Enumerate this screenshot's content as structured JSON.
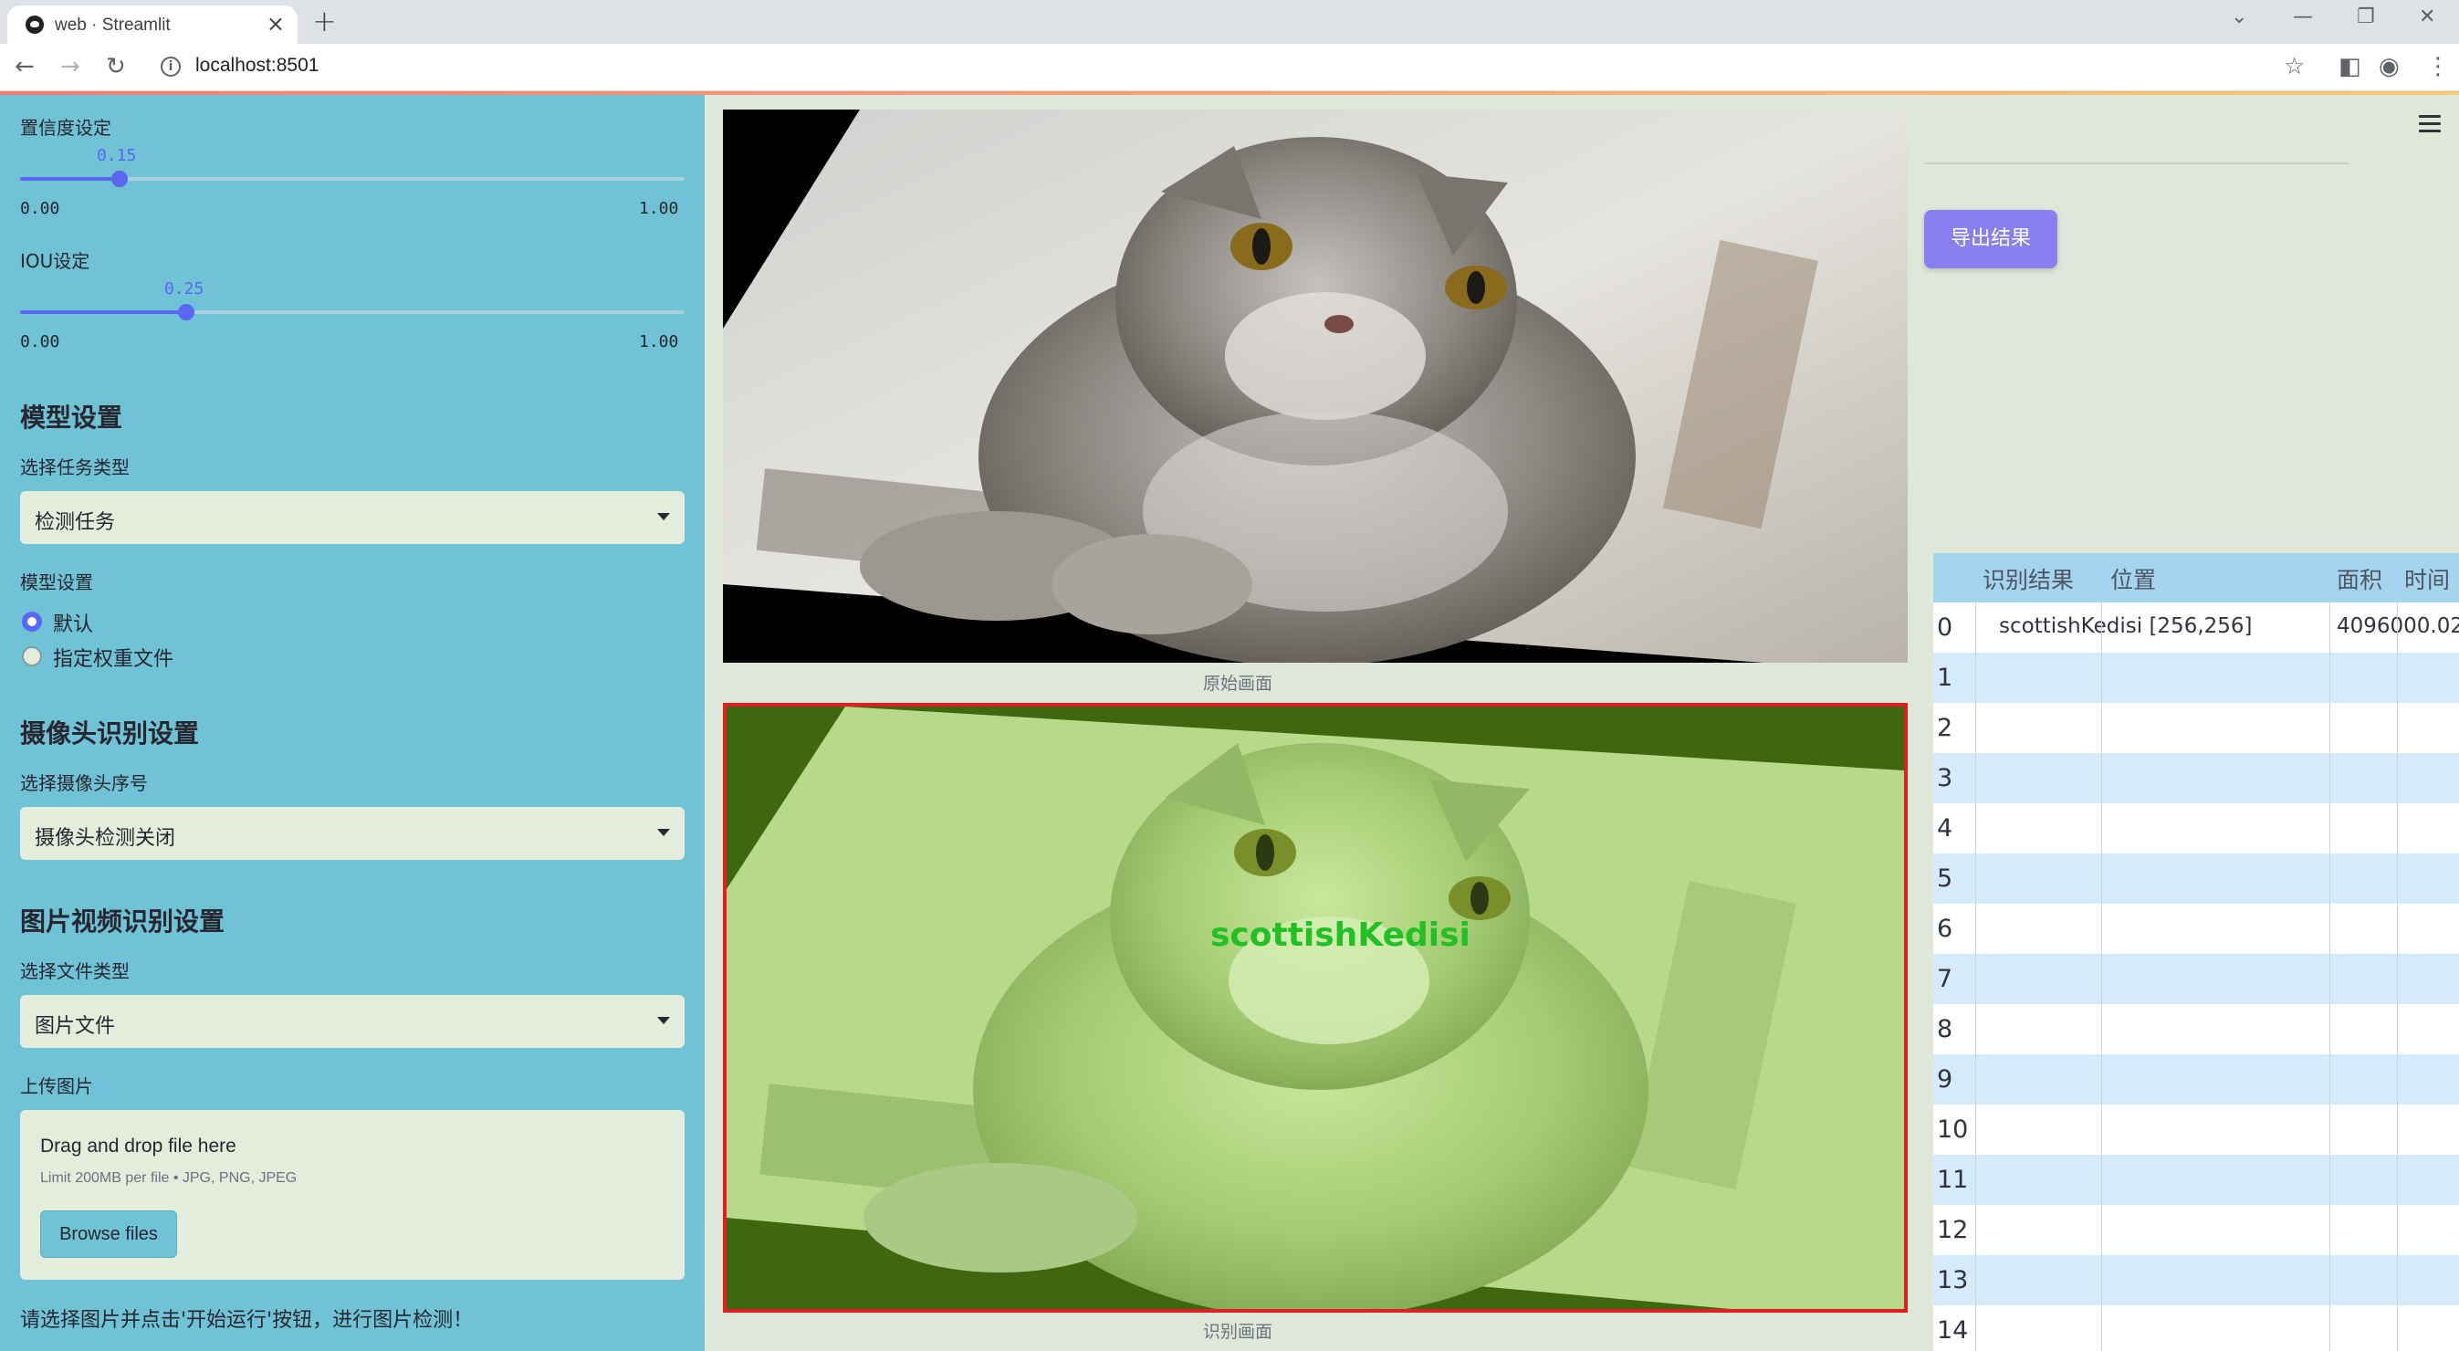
{
  "browser": {
    "tab_title": "web · Streamlit",
    "url": "localhost:8501"
  },
  "sidebar": {
    "confidence": {
      "label": "置信度设定",
      "value": "0.15",
      "min": "0.00",
      "max": "1.00",
      "fraction": 0.15
    },
    "iou": {
      "label": "IOU设定",
      "value": "0.25",
      "min": "0.00",
      "max": "1.00",
      "fraction": 0.25
    },
    "model_section": "模型设置",
    "task_label": "选择任务类型",
    "task_value": "检测任务",
    "model_label": "模型设置",
    "model_options": [
      "默认",
      "指定权重文件"
    ],
    "camera_section": "摄像头识别设置",
    "camera_label": "选择摄像头序号",
    "camera_value": "摄像头检测关闭",
    "media_section": "图片视频识别设置",
    "file_type_label": "选择文件类型",
    "file_type_value": "图片文件",
    "upload_label": "上传图片",
    "upload_title": "Drag and drop file here",
    "upload_limit": "Limit 200MB per file • JPG, PNG, JPEG",
    "browse_label": "Browse files",
    "hint": "请选择图片并点击'开始运行'按钮，进行图片检测！"
  },
  "main": {
    "original_caption": "原始画面",
    "result_caption": "识别画面",
    "detection_label": "scottishKedisi",
    "export_label": "导出结果"
  },
  "table": {
    "headers": [
      "识别结果",
      "位置",
      "面积",
      "时间"
    ],
    "row_indices": [
      "0",
      "1",
      "2",
      "3",
      "4",
      "5",
      "6",
      "7",
      "8",
      "9",
      "10",
      "11",
      "12",
      "13",
      "14"
    ],
    "rows": [
      {
        "result": "scottishKedisi",
        "position": "[256,256]",
        "area": "4096000.02"
      }
    ]
  },
  "colors": {
    "sidebar_bg": "#70c2d6",
    "accent": "#5a67f2",
    "export_button": "#8a7ff0",
    "detection_box": "#e02020",
    "mask_green": "#9be05a",
    "label_green": "#22c022"
  }
}
